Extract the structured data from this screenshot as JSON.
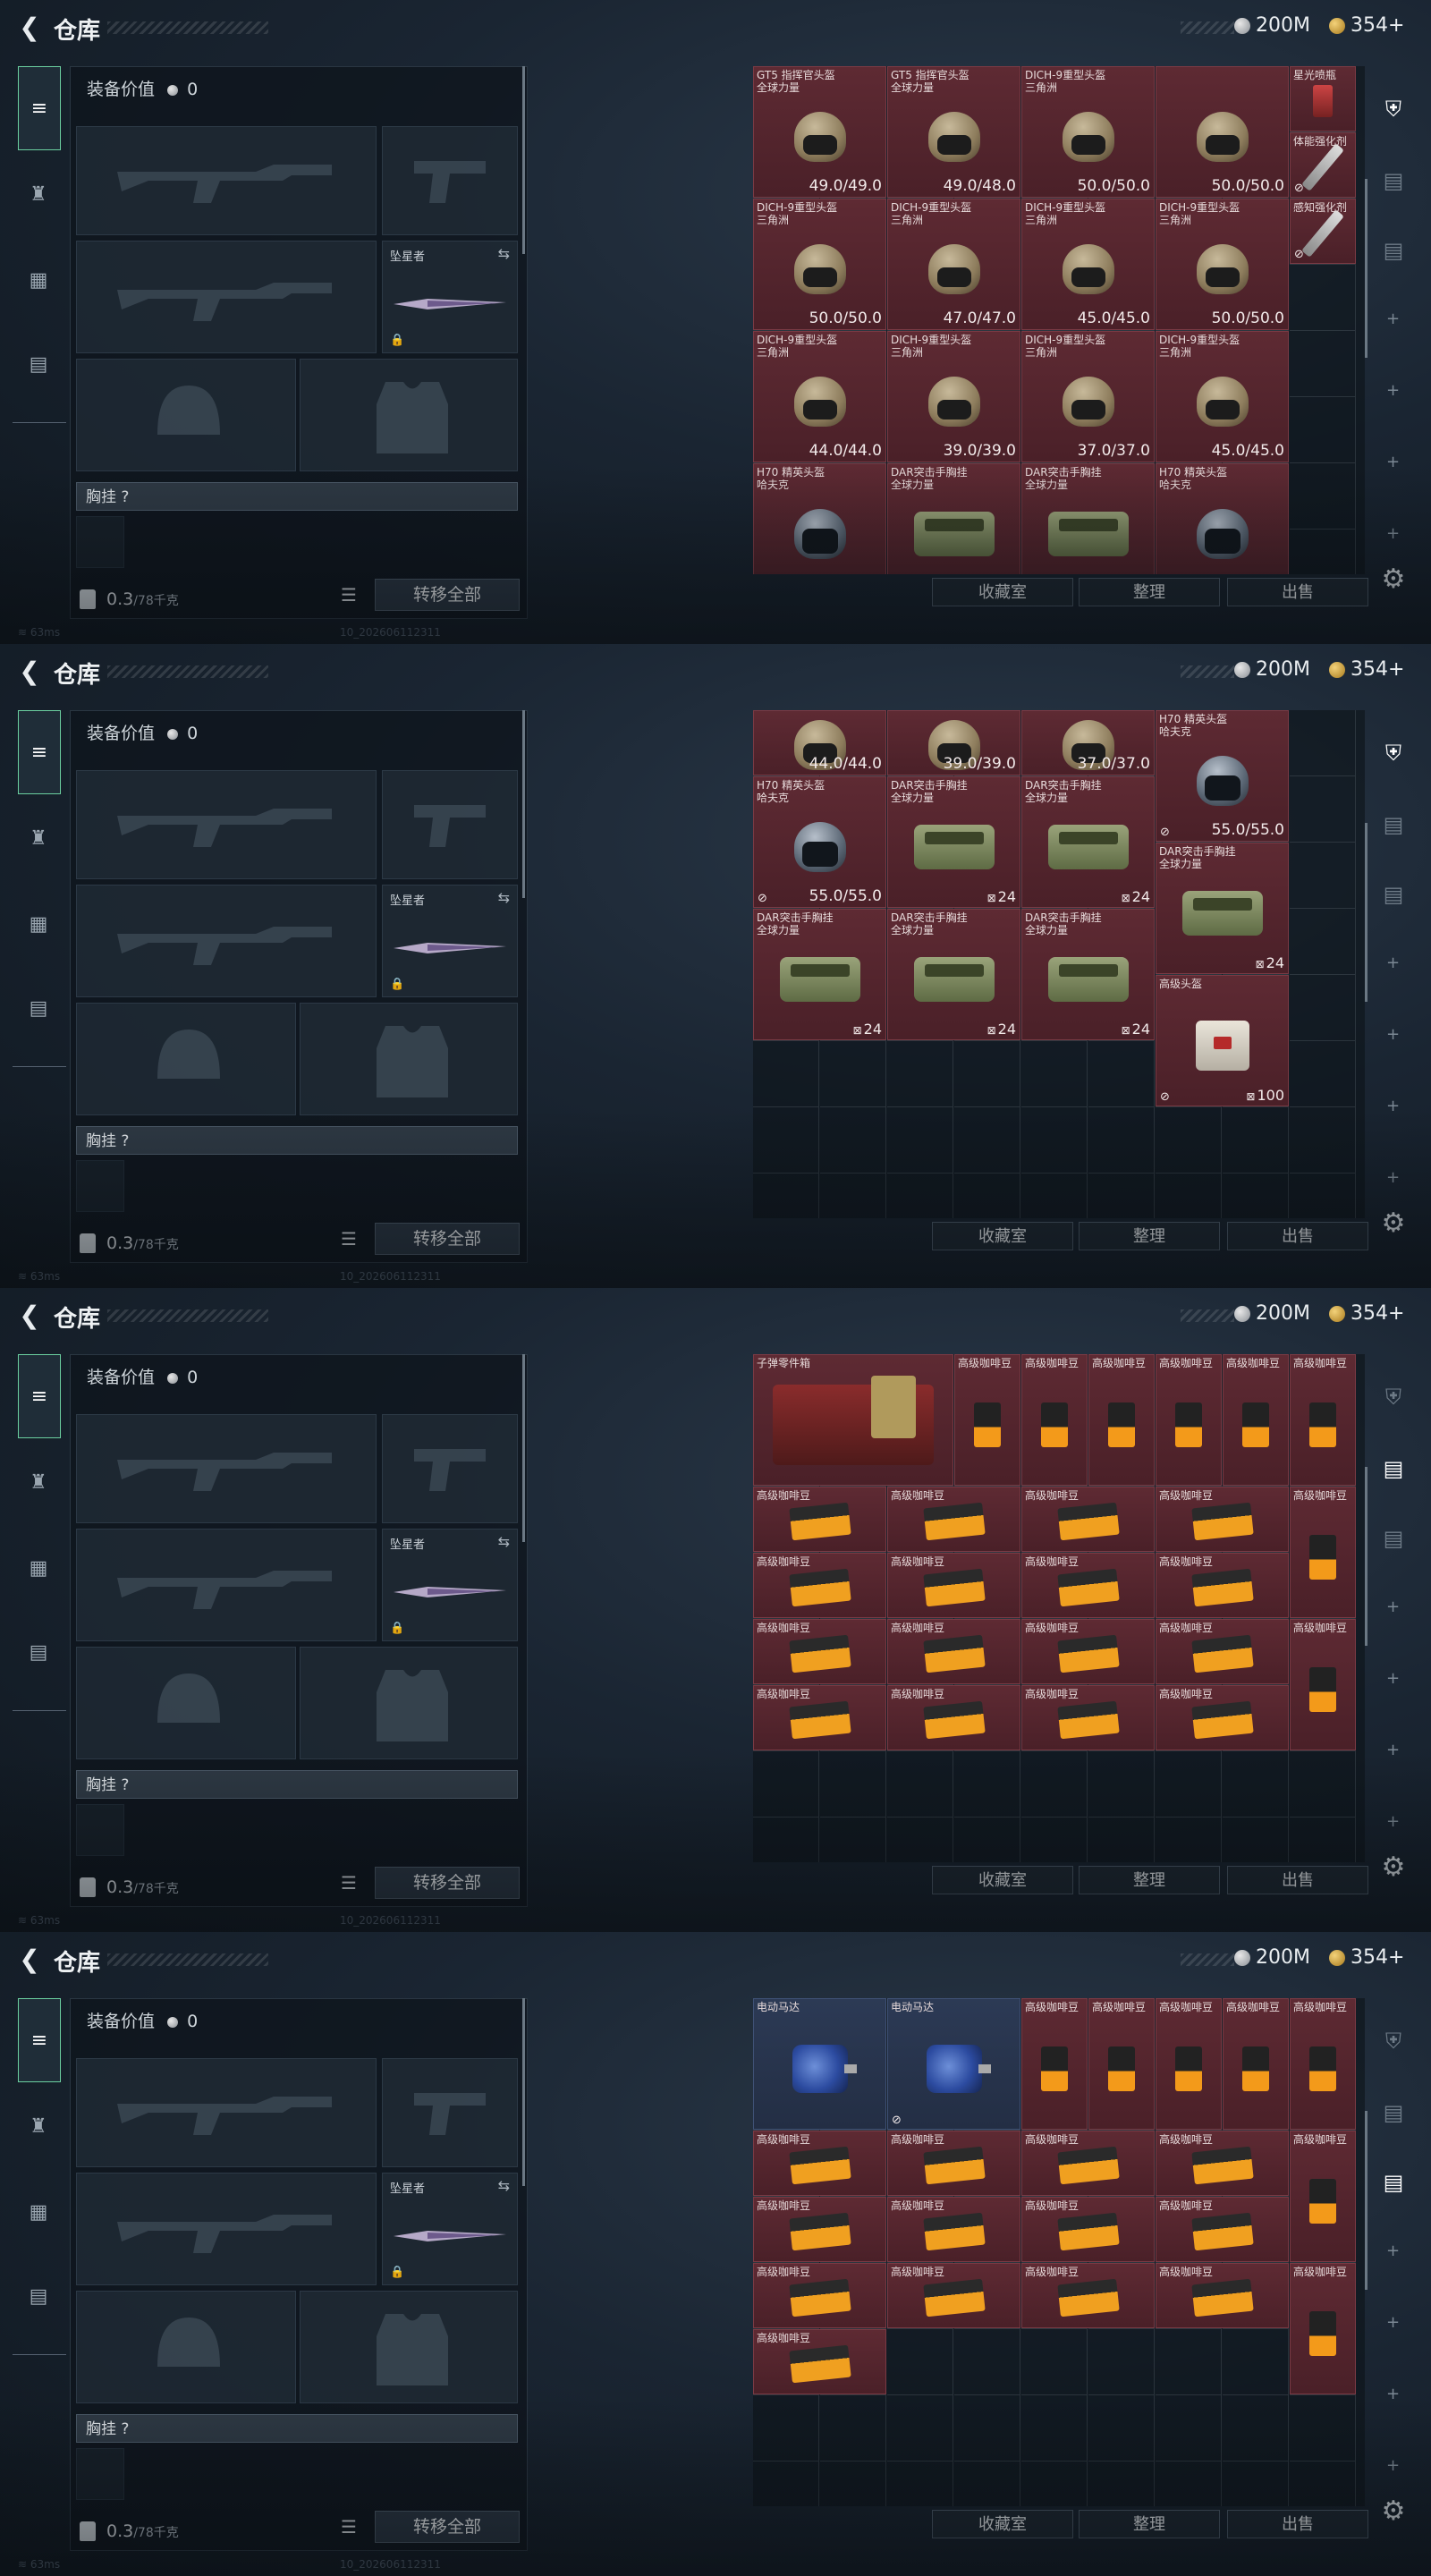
{
  "header": {
    "title": "仓库",
    "silver": "200M",
    "gold": "354+"
  },
  "loadout": {
    "equip_label": "装备价值",
    "equip_value": "0",
    "melee_name": "坠星者",
    "chest_label": "胸挂",
    "chest_value": "?",
    "weight": "0.3",
    "weight_max": "/78千克",
    "transfer_label": "转移全部"
  },
  "buttons": {
    "collection": "收藏室",
    "sort": "整理",
    "sell": "出售"
  },
  "footer": {
    "ping": "63ms",
    "build": "10_202606112311"
  },
  "stashes": [
    [
      {
        "c": 0,
        "r": 0,
        "w": 2,
        "h": 2,
        "name": "GT5 指挥官头盔\n全球力量",
        "art": "helm",
        "dur": "49.0/49.0"
      },
      {
        "c": 2,
        "r": 0,
        "w": 2,
        "h": 2,
        "name": "GT5 指挥官头盔\n全球力量",
        "art": "helm",
        "dur": "49.0/48.0"
      },
      {
        "c": 4,
        "r": 0,
        "w": 2,
        "h": 2,
        "name": "DICH-9重型头盔\n三角洲",
        "art": "helm",
        "dur": "50.0/50.0"
      },
      {
        "c": 6,
        "r": 0,
        "w": 2,
        "h": 2,
        "name": "",
        "art": "helm",
        "dur": "50.0/50.0"
      },
      {
        "c": 8,
        "r": 0,
        "w": 1,
        "h": 1,
        "name": "星光喷瓶",
        "art": "potion"
      },
      {
        "c": 6,
        "r": 2,
        "w": 2,
        "h": 2,
        "name": "DICH-9重型头盔\n三角洲",
        "art": "helm",
        "dur": "50.0/50.0"
      },
      {
        "c": 8,
        "r": 1,
        "w": 1,
        "h": 1,
        "name": "体能强化剂",
        "art": "syringe",
        "mark": "⊘"
      },
      {
        "c": 8,
        "r": 2,
        "w": 1,
        "h": 1,
        "name": "感知强化剂",
        "art": "syringe",
        "mark": "⊘"
      },
      {
        "c": 0,
        "r": 2,
        "w": 2,
        "h": 2,
        "name": "DICH-9重型头盔\n三角洲",
        "art": "helm",
        "dur": "50.0/50.0"
      },
      {
        "c": 2,
        "r": 2,
        "w": 2,
        "h": 2,
        "name": "DICH-9重型头盔\n三角洲",
        "art": "helm",
        "dur": "47.0/47.0"
      },
      {
        "c": 4,
        "r": 2,
        "w": 2,
        "h": 2,
        "name": "DICH-9重型头盔\n三角洲",
        "art": "helm",
        "dur": "45.0/45.0"
      },
      {
        "c": 6,
        "r": 4,
        "w": 2,
        "h": 2,
        "name": "DICH-9重型头盔\n三角洲",
        "art": "helm",
        "dur": "45.0/45.0"
      },
      {
        "c": 0,
        "r": 4,
        "w": 2,
        "h": 2,
        "name": "DICH-9重型头盔\n三角洲",
        "art": "helm",
        "dur": "44.0/44.0"
      },
      {
        "c": 2,
        "r": 4,
        "w": 2,
        "h": 2,
        "name": "DICH-9重型头盔\n三角洲",
        "art": "helm",
        "dur": "39.0/39.0"
      },
      {
        "c": 4,
        "r": 4,
        "w": 2,
        "h": 2,
        "name": "DICH-9重型头盔\n三角洲",
        "art": "helm",
        "dur": "37.0/37.0"
      },
      {
        "c": 6,
        "r": 6,
        "w": 2,
        "h": 2,
        "name": "H70 精英头盔\n哈夫克",
        "art": "helmd",
        "dur": "55.0/55.0",
        "mark": "⊘"
      },
      {
        "c": 0,
        "r": 6,
        "w": 2,
        "h": 2,
        "name": "H70 精英头盔\n哈夫克",
        "art": "helmd"
      },
      {
        "c": 2,
        "r": 6,
        "w": 2,
        "h": 2,
        "name": "DAR突击手胸挂\n全球力量",
        "art": "rig"
      },
      {
        "c": 4,
        "r": 6,
        "w": 2,
        "h": 2,
        "name": "DAR突击手胸挂\n全球力量",
        "art": "rig"
      }
    ],
    [
      {
        "c": 0,
        "r": 0,
        "w": 2,
        "h": 1,
        "name": "",
        "art": "helm",
        "dur": "44.0/44.0"
      },
      {
        "c": 2,
        "r": 0,
        "w": 2,
        "h": 1,
        "name": "",
        "art": "helm",
        "dur": "39.0/39.0"
      },
      {
        "c": 4,
        "r": 0,
        "w": 2,
        "h": 1,
        "name": "",
        "art": "helm",
        "dur": "37.0/37.0"
      },
      {
        "c": 6,
        "r": 0,
        "w": 2,
        "h": 2,
        "name": "H70 精英头盔\n哈夫克",
        "art": "helmd",
        "dur": "55.0/55.0",
        "mark": "⊘"
      },
      {
        "c": 0,
        "r": 1,
        "w": 2,
        "h": 2,
        "name": "H70 精英头盔\n哈夫克",
        "art": "helmd",
        "dur": "55.0/55.0",
        "mark": "⊘"
      },
      {
        "c": 2,
        "r": 1,
        "w": 2,
        "h": 2,
        "name": "DAR突击手胸挂\n全球力量",
        "art": "rig",
        "cnt": "24"
      },
      {
        "c": 4,
        "r": 1,
        "w": 2,
        "h": 2,
        "name": "DAR突击手胸挂\n全球力量",
        "art": "rig",
        "cnt": "24"
      },
      {
        "c": 6,
        "r": 2,
        "w": 2,
        "h": 2,
        "name": "DAR突击手胸挂\n全球力量",
        "art": "rig",
        "cnt": "24"
      },
      {
        "c": 0,
        "r": 3,
        "w": 2,
        "h": 2,
        "name": "DAR突击手胸挂\n全球力量",
        "art": "rig",
        "cnt": "24"
      },
      {
        "c": 2,
        "r": 3,
        "w": 2,
        "h": 2,
        "name": "DAR突击手胸挂\n全球力量",
        "art": "rig",
        "cnt": "24"
      },
      {
        "c": 4,
        "r": 3,
        "w": 2,
        "h": 2,
        "name": "DAR突击手胸挂\n全球力量",
        "art": "rig",
        "cnt": "24"
      },
      {
        "c": 6,
        "r": 4,
        "w": 2,
        "h": 2,
        "name": "高级头盔",
        "art": "bag",
        "cnt": "100",
        "mark": "⊘"
      }
    ],
    [
      {
        "c": 0,
        "r": 0,
        "w": 3,
        "h": 2,
        "name": "子弹零件箱",
        "art": "workbench"
      },
      {
        "c": 3,
        "r": 0,
        "w": 1,
        "h": 2,
        "name": "高级咖啡豆",
        "art": "coffee"
      },
      {
        "c": 4,
        "r": 0,
        "w": 1,
        "h": 2,
        "name": "高级咖啡豆",
        "art": "coffee"
      },
      {
        "c": 5,
        "r": 0,
        "w": 1,
        "h": 2,
        "name": "高级咖啡豆",
        "art": "coffee"
      },
      {
        "c": 6,
        "r": 0,
        "w": 1,
        "h": 2,
        "name": "高级咖啡豆",
        "art": "coffee"
      },
      {
        "c": 7,
        "r": 0,
        "w": 1,
        "h": 2,
        "name": "高级咖啡豆",
        "art": "coffee"
      },
      {
        "c": 8,
        "r": 0,
        "w": 1,
        "h": 2,
        "name": "高级咖啡豆",
        "art": "coffee"
      },
      {
        "c": 0,
        "r": 2,
        "w": 2,
        "h": 1,
        "name": "高级咖啡豆",
        "art": "coffeew"
      },
      {
        "c": 2,
        "r": 2,
        "w": 2,
        "h": 1,
        "name": "高级咖啡豆",
        "art": "coffeew"
      },
      {
        "c": 4,
        "r": 2,
        "w": 2,
        "h": 1,
        "name": "高级咖啡豆",
        "art": "coffeew"
      },
      {
        "c": 6,
        "r": 2,
        "w": 2,
        "h": 1,
        "name": "高级咖啡豆",
        "art": "coffeew"
      },
      {
        "c": 8,
        "r": 2,
        "w": 1,
        "h": 2,
        "name": "高级咖啡豆",
        "art": "coffee"
      },
      {
        "c": 0,
        "r": 3,
        "w": 2,
        "h": 1,
        "name": "高级咖啡豆",
        "art": "coffeew"
      },
      {
        "c": 2,
        "r": 3,
        "w": 2,
        "h": 1,
        "name": "高级咖啡豆",
        "art": "coffeew"
      },
      {
        "c": 4,
        "r": 3,
        "w": 2,
        "h": 1,
        "name": "高级咖啡豆",
        "art": "coffeew"
      },
      {
        "c": 6,
        "r": 3,
        "w": 2,
        "h": 1,
        "name": "高级咖啡豆",
        "art": "coffeew"
      },
      {
        "c": 0,
        "r": 4,
        "w": 2,
        "h": 1,
        "name": "高级咖啡豆",
        "art": "coffeew"
      },
      {
        "c": 2,
        "r": 4,
        "w": 2,
        "h": 1,
        "name": "高级咖啡豆",
        "art": "coffeew"
      },
      {
        "c": 4,
        "r": 4,
        "w": 2,
        "h": 1,
        "name": "高级咖啡豆",
        "art": "coffeew"
      },
      {
        "c": 6,
        "r": 4,
        "w": 2,
        "h": 1,
        "name": "高级咖啡豆",
        "art": "coffeew"
      },
      {
        "c": 8,
        "r": 4,
        "w": 1,
        "h": 2,
        "name": "高级咖啡豆",
        "art": "coffee"
      },
      {
        "c": 0,
        "r": 5,
        "w": 2,
        "h": 1,
        "name": "高级咖啡豆",
        "art": "coffeew"
      },
      {
        "c": 2,
        "r": 5,
        "w": 2,
        "h": 1,
        "name": "高级咖啡豆",
        "art": "coffeew"
      },
      {
        "c": 4,
        "r": 5,
        "w": 2,
        "h": 1,
        "name": "高级咖啡豆",
        "art": "coffeew"
      },
      {
        "c": 6,
        "r": 5,
        "w": 2,
        "h": 1,
        "name": "高级咖啡豆",
        "art": "coffeew"
      }
    ],
    [
      {
        "c": 0,
        "r": 0,
        "w": 2,
        "h": 2,
        "name": "电动马达",
        "art": "motor",
        "blue": true
      },
      {
        "c": 2,
        "r": 0,
        "w": 2,
        "h": 2,
        "name": "电动马达",
        "art": "motor",
        "blue": true,
        "mark": "⊘"
      },
      {
        "c": 4,
        "r": 0,
        "w": 1,
        "h": 2,
        "name": "高级咖啡豆",
        "art": "coffee"
      },
      {
        "c": 5,
        "r": 0,
        "w": 1,
        "h": 2,
        "name": "高级咖啡豆",
        "art": "coffee"
      },
      {
        "c": 6,
        "r": 0,
        "w": 1,
        "h": 2,
        "name": "高级咖啡豆",
        "art": "coffee"
      },
      {
        "c": 7,
        "r": 0,
        "w": 1,
        "h": 2,
        "name": "高级咖啡豆",
        "art": "coffee"
      },
      {
        "c": 8,
        "r": 0,
        "w": 1,
        "h": 2,
        "name": "高级咖啡豆",
        "art": "coffee"
      },
      {
        "c": 0,
        "r": 2,
        "w": 2,
        "h": 1,
        "name": "高级咖啡豆",
        "art": "coffeew"
      },
      {
        "c": 2,
        "r": 2,
        "w": 2,
        "h": 1,
        "name": "高级咖啡豆",
        "art": "coffeew"
      },
      {
        "c": 4,
        "r": 2,
        "w": 2,
        "h": 1,
        "name": "高级咖啡豆",
        "art": "coffeew"
      },
      {
        "c": 6,
        "r": 2,
        "w": 2,
        "h": 1,
        "name": "高级咖啡豆",
        "art": "coffeew"
      },
      {
        "c": 8,
        "r": 2,
        "w": 1,
        "h": 2,
        "name": "高级咖啡豆",
        "art": "coffee"
      },
      {
        "c": 0,
        "r": 3,
        "w": 2,
        "h": 1,
        "name": "高级咖啡豆",
        "art": "coffeew"
      },
      {
        "c": 2,
        "r": 3,
        "w": 2,
        "h": 1,
        "name": "高级咖啡豆",
        "art": "coffeew"
      },
      {
        "c": 4,
        "r": 3,
        "w": 2,
        "h": 1,
        "name": "高级咖啡豆",
        "art": "coffeew"
      },
      {
        "c": 6,
        "r": 3,
        "w": 2,
        "h": 1,
        "name": "高级咖啡豆",
        "art": "coffeew"
      },
      {
        "c": 0,
        "r": 4,
        "w": 2,
        "h": 1,
        "name": "高级咖啡豆",
        "art": "coffeew"
      },
      {
        "c": 2,
        "r": 4,
        "w": 2,
        "h": 1,
        "name": "高级咖啡豆",
        "art": "coffeew"
      },
      {
        "c": 4,
        "r": 4,
        "w": 2,
        "h": 1,
        "name": "高级咖啡豆",
        "art": "coffeew"
      },
      {
        "c": 6,
        "r": 4,
        "w": 2,
        "h": 1,
        "name": "高级咖啡豆",
        "art": "coffeew"
      },
      {
        "c": 8,
        "r": 4,
        "w": 1,
        "h": 2,
        "name": "高级咖啡豆",
        "art": "coffee"
      },
      {
        "c": 0,
        "r": 5,
        "w": 2,
        "h": 1,
        "name": "高级咖啡豆",
        "art": "coffeew"
      }
    ]
  ]
}
